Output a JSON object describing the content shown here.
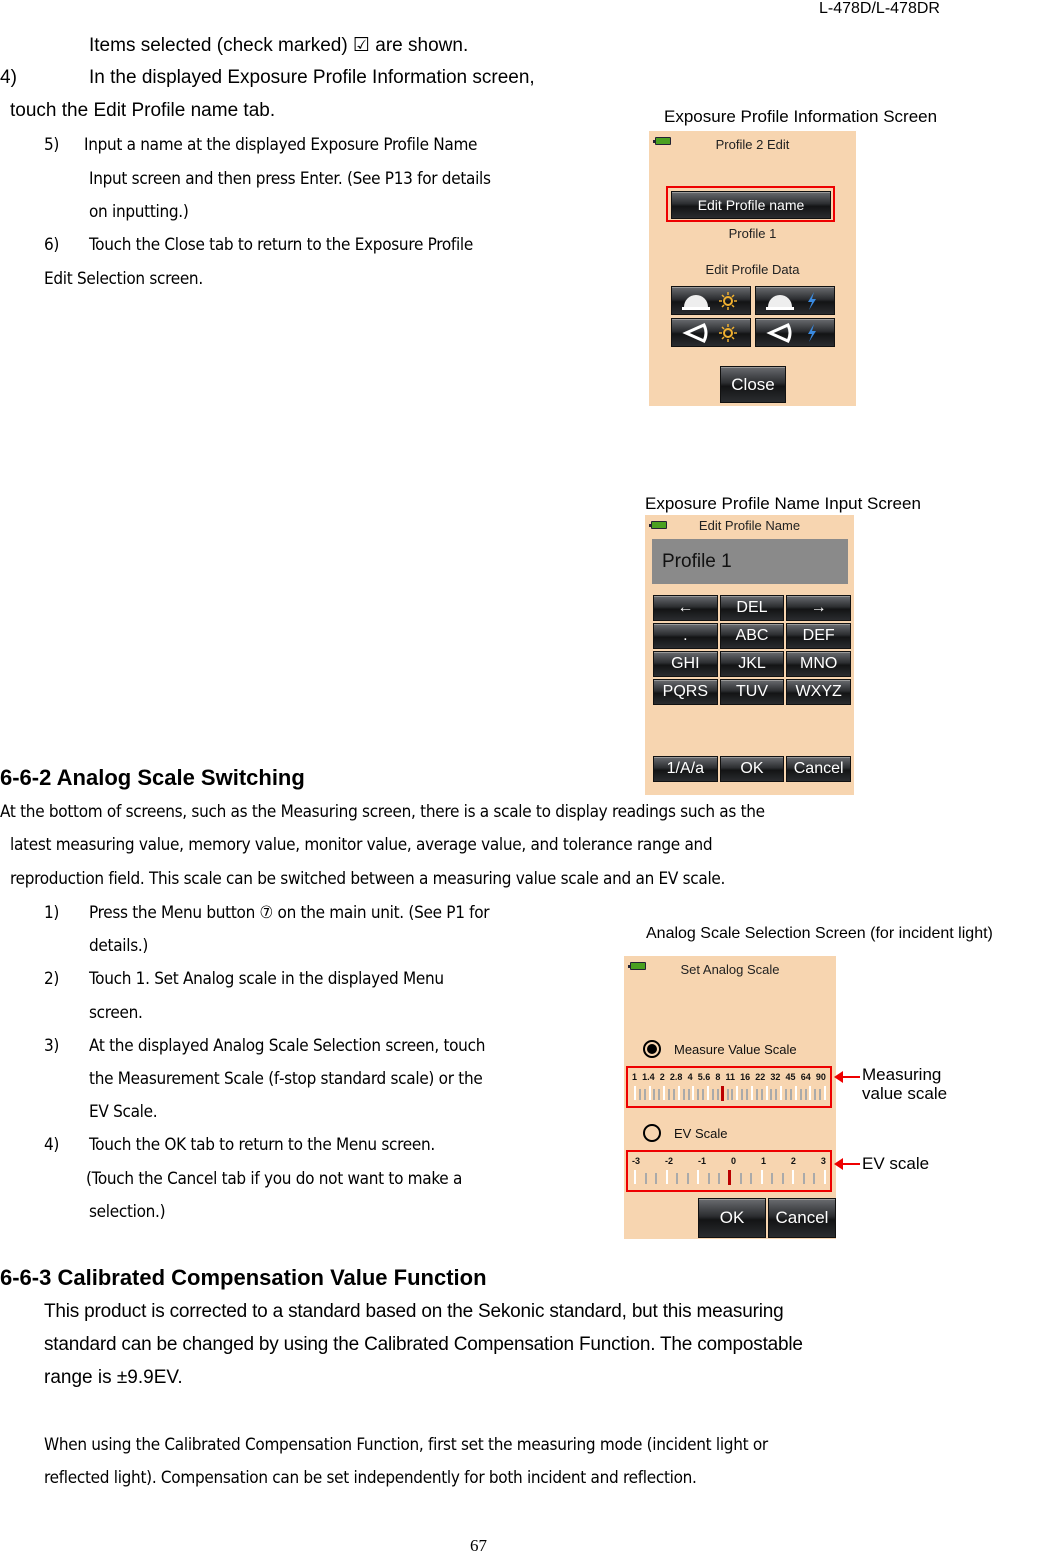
{
  "header": {
    "model": "L-478D/L-478DR"
  },
  "top_text": {
    "line1": "Items selected (check marked)  ☑  are shown.",
    "step4_num": "4)",
    "step4_a": "In the displayed Exposure Profile Information screen,",
    "step4_b": "touch the Edit Profile name tab.",
    "step5_num": "5)",
    "step5_a": "Input a name at the displayed Exposure Profile Name",
    "step5_b": "Input screen and then press Enter. (See P13 for details",
    "step5_c": "on inputting.)",
    "step6_num": "6)",
    "step6_a": "Touch the Close tab to return to the Exposure Profile",
    "step6_b": "Edit Selection screen."
  },
  "profile_info_screen": {
    "caption": "Exposure Profile Information Screen",
    "title": "Profile 2 Edit",
    "edit_name_button": "Edit Profile name",
    "profile_name": "Profile 1",
    "edit_data_label": "Edit Profile Data",
    "data_buttons": [
      {
        "mode": "incident-dome",
        "light": "ambient-sun"
      },
      {
        "mode": "incident-dome",
        "light": "flash-bolt"
      },
      {
        "mode": "reflected-lumisphere",
        "light": "ambient-sun"
      },
      {
        "mode": "reflected-lumisphere",
        "light": "flash-bolt"
      }
    ],
    "close_button": "Close"
  },
  "name_input_screen": {
    "caption": "Exposure Profile Name Input Screen",
    "title": "Edit Profile Name",
    "input_value": "Profile 1",
    "keys": [
      "←",
      "DEL",
      "→",
      ".",
      "ABC",
      "DEF",
      "GHI",
      "JKL",
      "MNO",
      "PQRS",
      "TUV",
      "WXYZ"
    ],
    "bottom_keys": [
      "1/A/a",
      "OK",
      "Cancel"
    ]
  },
  "section_662": {
    "heading": "6-6-2 Analog Scale Switching",
    "intro_1": "At the bottom of screens, such as the Measuring screen, there is a scale to display readings such as the",
    "intro_2": "latest measuring value, memory value, monitor value, average value, and tolerance range and",
    "intro_3": "reproduction field. This scale can be switched between a measuring value scale and an EV scale.",
    "steps": [
      {
        "num": "1)",
        "lines": [
          "Press the Menu button  ⑦  on the main unit. (See P1 for",
          "details.)"
        ]
      },
      {
        "num": "2)",
        "lines": [
          "Touch 1. Set Analog scale in the displayed Menu",
          "screen."
        ]
      },
      {
        "num": "3)",
        "lines": [
          "At the displayed Analog Scale Selection screen, touch",
          "the Measurement Scale (f‐stop standard scale) or the",
          "EV Scale."
        ]
      },
      {
        "num": "4)",
        "lines": [
          "Touch the OK tab to return to the Menu screen.",
          "(Touch the Cancel tab if you do not want to make a",
          "selection.)"
        ]
      }
    ]
  },
  "analog_scale_screen": {
    "caption": "Analog Scale Selection Screen (for incident light)",
    "title": "Set Analog Scale",
    "option_measure": {
      "label": "Measure Value Scale",
      "selected": true
    },
    "option_ev": {
      "label": "EV Scale",
      "selected": false
    },
    "measure_ticks": [
      "1",
      "1.4",
      "2",
      "2.8",
      "4",
      "5.6",
      "8",
      "11",
      "16",
      "22",
      "32",
      "45",
      "64",
      "90"
    ],
    "measure_pointer_value": "8",
    "ev_ticks": [
      "-3",
      "-2",
      "-1",
      "0",
      "1",
      "2",
      "3"
    ],
    "ev_pointer_value": "0",
    "ok_button": "OK",
    "cancel_button": "Cancel",
    "annotation_measure": [
      "Measuring",
      "value scale"
    ],
    "annotation_ev": "EV scale",
    "accent_color": "#e00000"
  },
  "section_663": {
    "heading": "6-6-3 Calibrated Compensation Value Function",
    "p1_1": "This product is corrected to a standard based on the Sekonic standard, but this measuring",
    "p1_2": "standard can be changed by using the Calibrated Compensation Function. The compostable",
    "p1_3": "range is  ±9.9EV.",
    "p2_1": "When using the Calibrated Compensation Function, first set the measuring mode (incident light or",
    "p2_2": "reflected light). Compensation can be set independently for both incident and reflection."
  },
  "footer": {
    "page_number": "67"
  }
}
